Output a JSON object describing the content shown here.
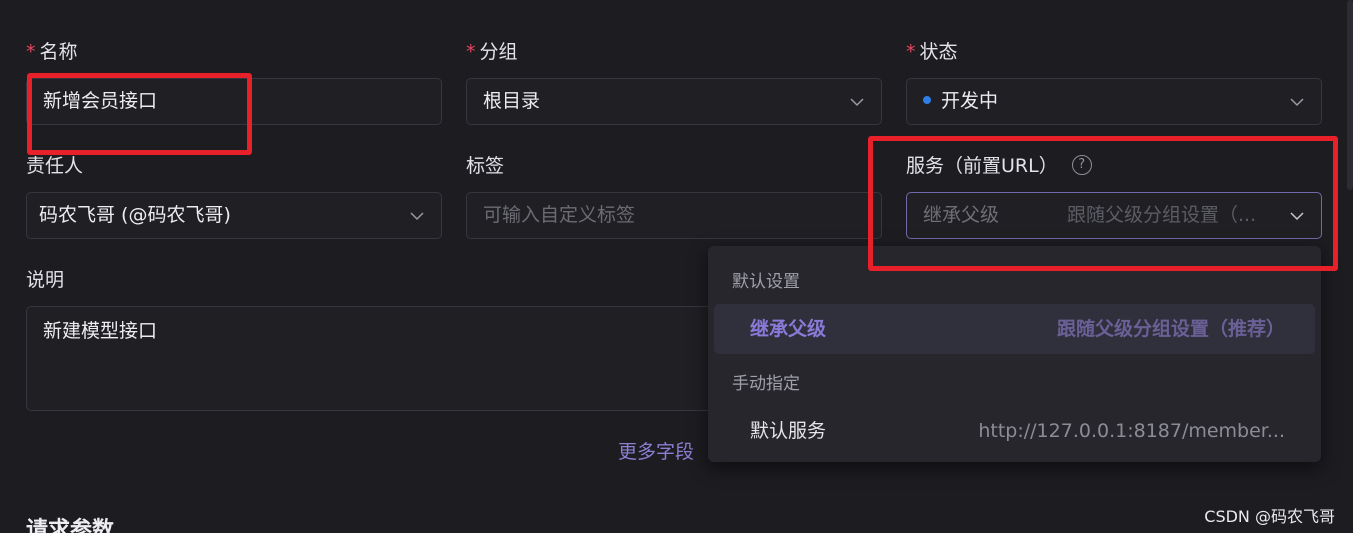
{
  "form": {
    "name": {
      "label": "名称",
      "required_mark": "*",
      "value": "新增会员接口"
    },
    "group": {
      "label": "分组",
      "required_mark": "*",
      "value": "根目录"
    },
    "status": {
      "label": "状态",
      "required_mark": "*",
      "value": "开发中",
      "dot_color": "#2f7fe8"
    },
    "owner": {
      "label": "责任人",
      "value": "码农飞哥 (@码农飞哥)"
    },
    "tags": {
      "label": "标签",
      "placeholder": "可输入自定义标签"
    },
    "service": {
      "label": "服务（前置URL）",
      "help_icon": "?",
      "value": "继承父级",
      "value_hint": "跟随父级分组设置（..."
    },
    "description": {
      "label": "说明",
      "value": "新建模型接口"
    },
    "more_fields": "更多字段"
  },
  "dropdown": {
    "groups": [
      {
        "title": "默认设置",
        "items": [
          {
            "name": "继承父级",
            "desc": "跟随父级分组设置（推荐）",
            "selected": true
          }
        ]
      },
      {
        "title": "手动指定",
        "items": [
          {
            "name": "默认服务",
            "desc": "http://127.0.0.1:8187/member...",
            "selected": false
          }
        ]
      }
    ]
  },
  "section": {
    "title": "请求参数"
  },
  "watermark": "CSDN @码农飞哥",
  "colors": {
    "background": "#1c1c21",
    "accent": "#8a7ad8",
    "required": "#e2475f",
    "highlight_box": "#e8202a"
  }
}
